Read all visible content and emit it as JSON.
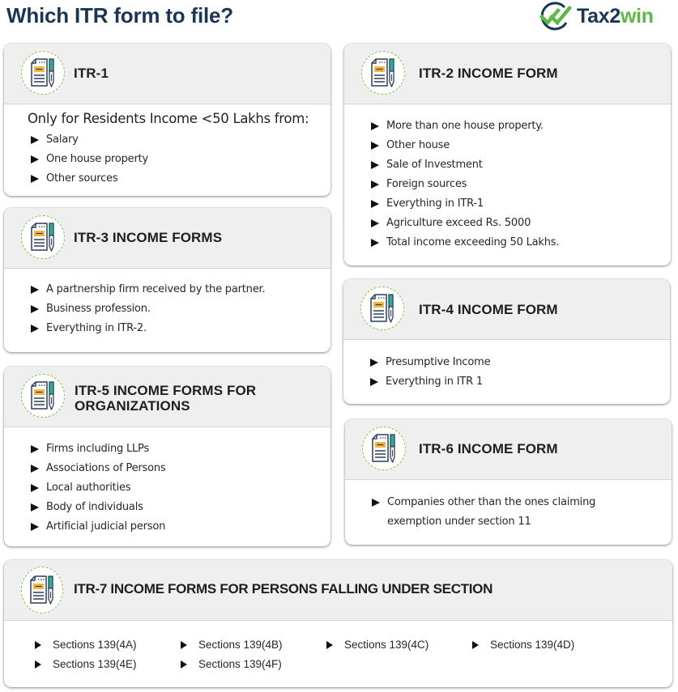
{
  "header": {
    "title": "Which ITR form to file?",
    "logo": {
      "icon": "double-check-icon",
      "text_primary": "Tax2",
      "text_accent": "win",
      "primary_color": "#1b3556",
      "accent_color": "#5cb946"
    }
  },
  "colors": {
    "title": "#1b3556",
    "card_header_bg": "#efefef",
    "badge_border": "#8cc152",
    "icon_yellow": "#f5b53f",
    "icon_teal": "#2bb09a"
  },
  "cards": {
    "itr1": {
      "title": "ITR-1",
      "icon": "document-pen-icon",
      "intro": "Only for Residents Income <50 Lakhs from:",
      "items": [
        "Salary",
        "One house property",
        "Other sources"
      ]
    },
    "itr2": {
      "title": "ITR-2 INCOME FORM",
      "icon": "document-pen-icon",
      "items": [
        "More than one house property.",
        "Other house",
        "Sale of Investment",
        "Foreign sources",
        "Everything in ITR-1",
        "Agriculture exceed Rs. 5000",
        "Total income exceeding 50 Lakhs."
      ]
    },
    "itr3": {
      "title": "ITR-3 INCOME FORMS",
      "icon": "document-pen-icon",
      "items": [
        "A partnership firm received by the partner.",
        "Business profession.",
        "Everything in ITR-2."
      ]
    },
    "itr4": {
      "title": "ITR-4 INCOME FORM",
      "icon": "document-pen-icon",
      "items": [
        "Presumptive Income",
        "Everything in ITR 1"
      ]
    },
    "itr5": {
      "title_line1": "ITR-5 INCOME FORMS FOR",
      "title_line2": "ORGANIZATIONS",
      "icon": "document-pen-icon",
      "items": [
        "Firms including LLPs",
        "Associations of Persons",
        "Local authorities",
        "Body of individuals",
        "Artificial judicial person"
      ]
    },
    "itr6": {
      "title": "ITR-6 INCOME FORM",
      "icon": "document-pen-icon",
      "items": [
        "Companies other than the ones claiming exemption under section 11"
      ]
    },
    "itr7": {
      "title": "ITR-7 INCOME FORMS FOR PERSONS FALLING UNDER SECTION",
      "icon": "document-pen-icon",
      "items": [
        "Sections 139(4A)",
        "Sections 139(4B)",
        "Sections 139(4C)",
        "Sections 139(4D)",
        "Sections 139(4E)",
        "Sections 139(4F)"
      ]
    }
  }
}
